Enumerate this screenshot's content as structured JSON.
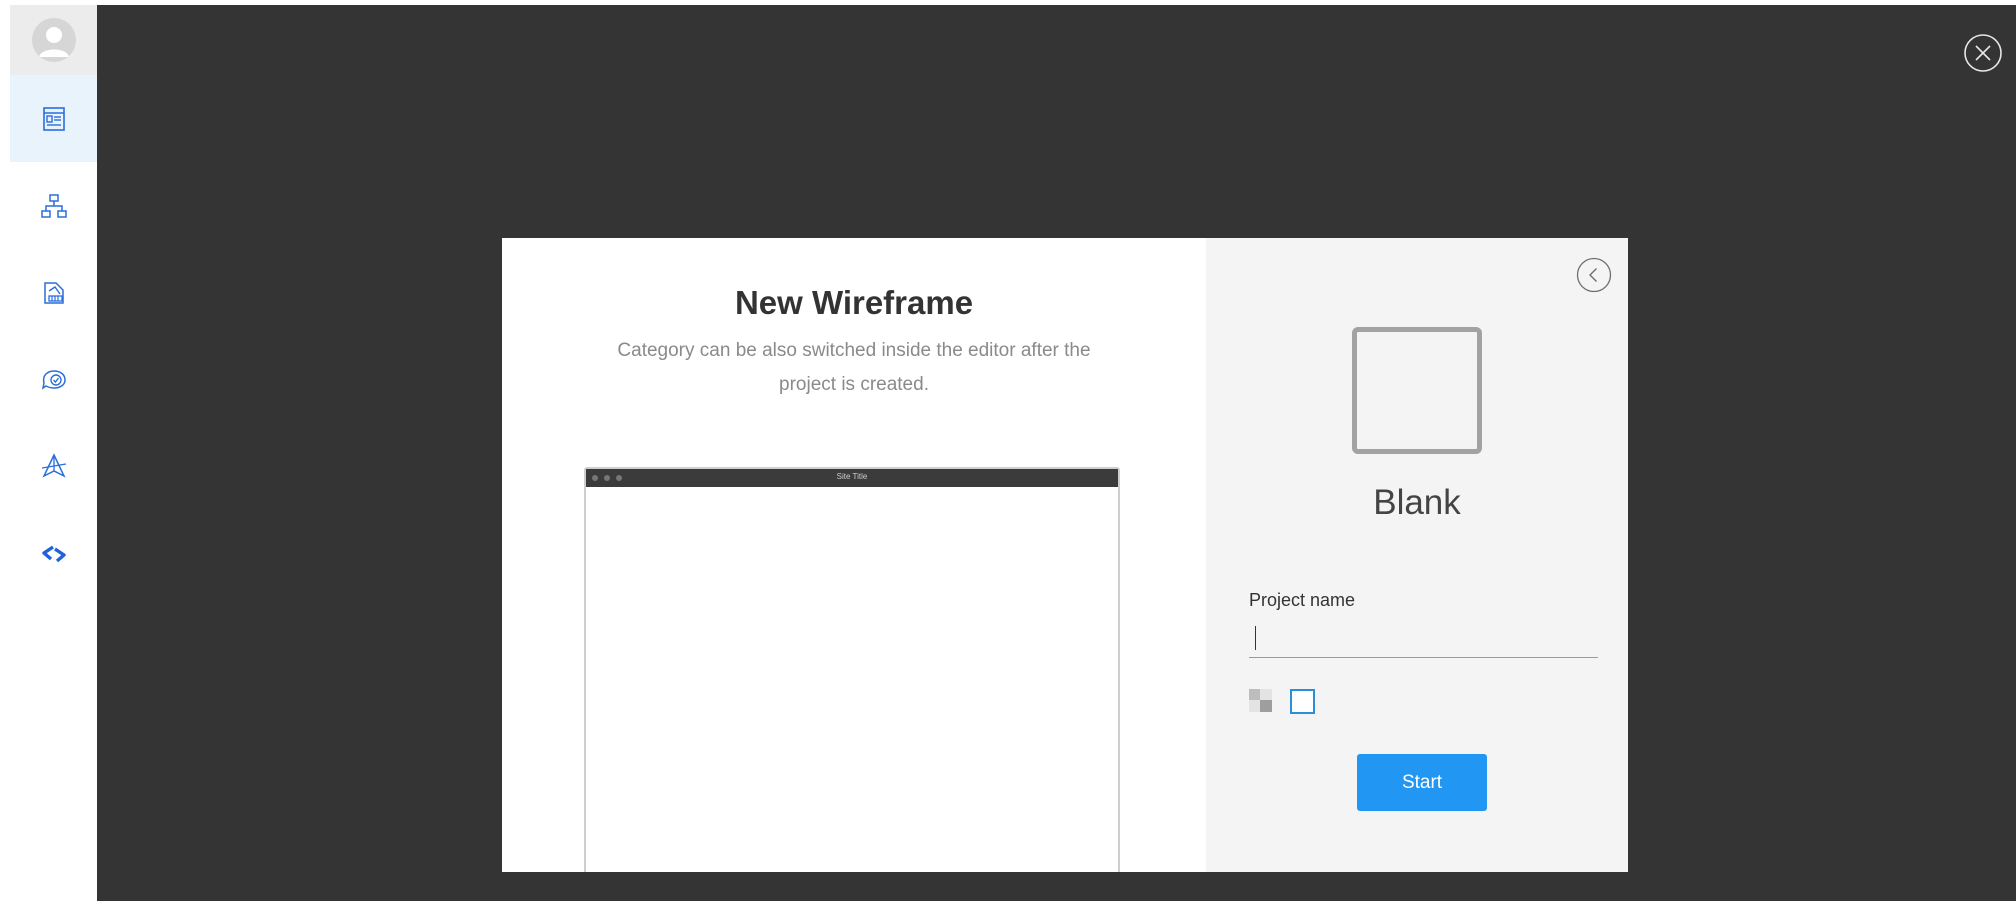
{
  "sidebar": {
    "avatar_icon": "user-avatar-icon",
    "items": [
      {
        "name": "wireframe",
        "icon": "wireframe-layout-icon",
        "active": true
      },
      {
        "name": "sitemap",
        "icon": "sitemap-icon",
        "active": false
      },
      {
        "name": "design",
        "icon": "design-palette-icon",
        "active": false
      },
      {
        "name": "feedback",
        "icon": "chat-check-icon",
        "active": false
      },
      {
        "name": "vector",
        "icon": "pen-tool-icon",
        "active": false
      },
      {
        "name": "code",
        "icon": "code-brackets-icon",
        "active": false
      }
    ],
    "accent_color": "#2a6fdb",
    "active_bg": "#e8f3fc"
  },
  "overlay": {
    "close_icon": "close-icon",
    "bg_color": "#343434"
  },
  "dialog": {
    "title": "New Wireframe",
    "subtitle": "Category can be also switched inside the editor after the project is created.",
    "preview": {
      "bar_title": "Site Title"
    },
    "right": {
      "back_icon": "chevron-left-icon",
      "template_name": "Blank",
      "project_name_label": "Project name",
      "project_name_value": "",
      "project_name_placeholder": "",
      "background_options": [
        "transparent",
        "white"
      ],
      "selected_background": "white",
      "start_label": "Start",
      "start_color": "#2196f3"
    }
  }
}
